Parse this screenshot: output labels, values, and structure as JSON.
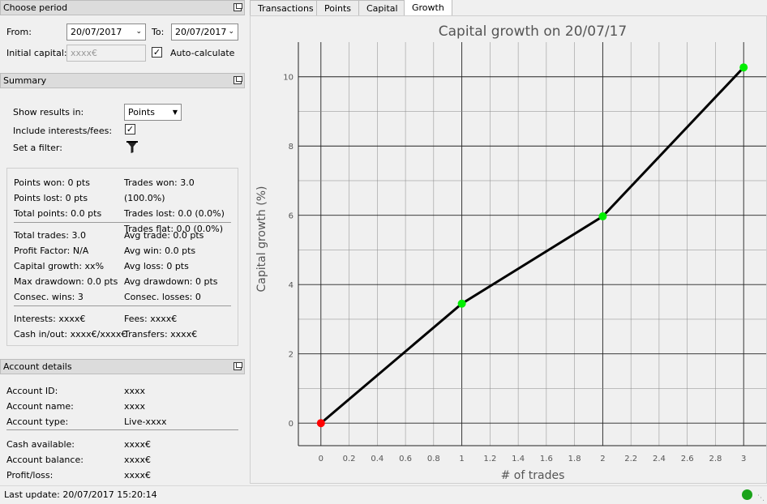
{
  "period": {
    "title": "Choose period",
    "from_label": "From:",
    "from_value": "20/07/2017",
    "to_label": "To:",
    "to_value": "20/07/2017",
    "initial_label": "Initial capital:",
    "initial_placeholder": "xxxx€",
    "autocalc_label": "Auto-calculate",
    "autocalc_checked": true
  },
  "summary": {
    "title": "Summary",
    "show_label": "Show results in:",
    "show_value": "Points",
    "interests_label": "Include interests/fees:",
    "interests_checked": true,
    "filter_label": "Set a filter:",
    "col1": [
      "Points won: 0 pts",
      "Points lost: 0 pts",
      "Total points: 0.0 pts"
    ],
    "col2": [
      "Trades won: 3.0 (100.0%)",
      "Trades lost: 0.0 (0.0%)",
      "Trades flat: 0.0 (0.0%)"
    ],
    "col3": [
      "Total trades: 3.0",
      "Profit Factor: N/A",
      "Capital growth: xx%",
      "Max drawdown: 0.0 pts",
      "Consec. wins: 3"
    ],
    "col4": [
      "Avg trade: 0.0 pts",
      "Avg win: 0.0 pts",
      "Avg loss: 0 pts",
      "Avg drawdown: 0 pts",
      "Consec. losses: 0"
    ],
    "col5": [
      "Interests: xxxx€",
      "Cash in/out: xxxx€/xxxx€"
    ],
    "col6": [
      "Fees: xxxx€",
      "Transfers: xxxx€"
    ]
  },
  "account": {
    "title": "Account details",
    "rows1": [
      {
        "label": "Account ID:",
        "value": "xxxx"
      },
      {
        "label": "Account name:",
        "value": "xxxx"
      },
      {
        "label": "Account type:",
        "value": "Live-xxxx"
      }
    ],
    "rows2": [
      {
        "label": "Cash available:",
        "value": "xxxx€"
      },
      {
        "label": "Account balance:",
        "value": "xxxx€"
      },
      {
        "label": "Profit/loss:",
        "value": "xxxx€"
      }
    ]
  },
  "status": {
    "last_update": "Last update: 20/07/2017 15:20:14",
    "indicator_color": "#1aa31a"
  },
  "tabs": [
    "Transactions",
    "Points",
    "Capital",
    "Growth"
  ],
  "active_tab": "Growth",
  "chart_data": {
    "type": "line",
    "title": "Capital growth on 20/07/17",
    "xlabel": "# of trades",
    "ylabel": "Capital growth (%)",
    "x": [
      0,
      1,
      2,
      3
    ],
    "y": [
      0,
      3.45,
      5.97,
      10.27
    ],
    "point_colors": [
      "#ff0000",
      "#00ee00",
      "#00ee00",
      "#00ee00"
    ],
    "xlim": [
      -0.16,
      3.16
    ],
    "ylim": [
      -0.65,
      11.0
    ],
    "xticks": [
      "0",
      "0.2",
      "0.4",
      "0.6",
      "0.8",
      "1",
      "1.2",
      "1.4",
      "1.6",
      "1.8",
      "2",
      "2.2",
      "2.4",
      "2.6",
      "2.8",
      "3"
    ],
    "yticks": [
      "0",
      "2",
      "4",
      "6",
      "8",
      "10"
    ],
    "grid": true
  }
}
